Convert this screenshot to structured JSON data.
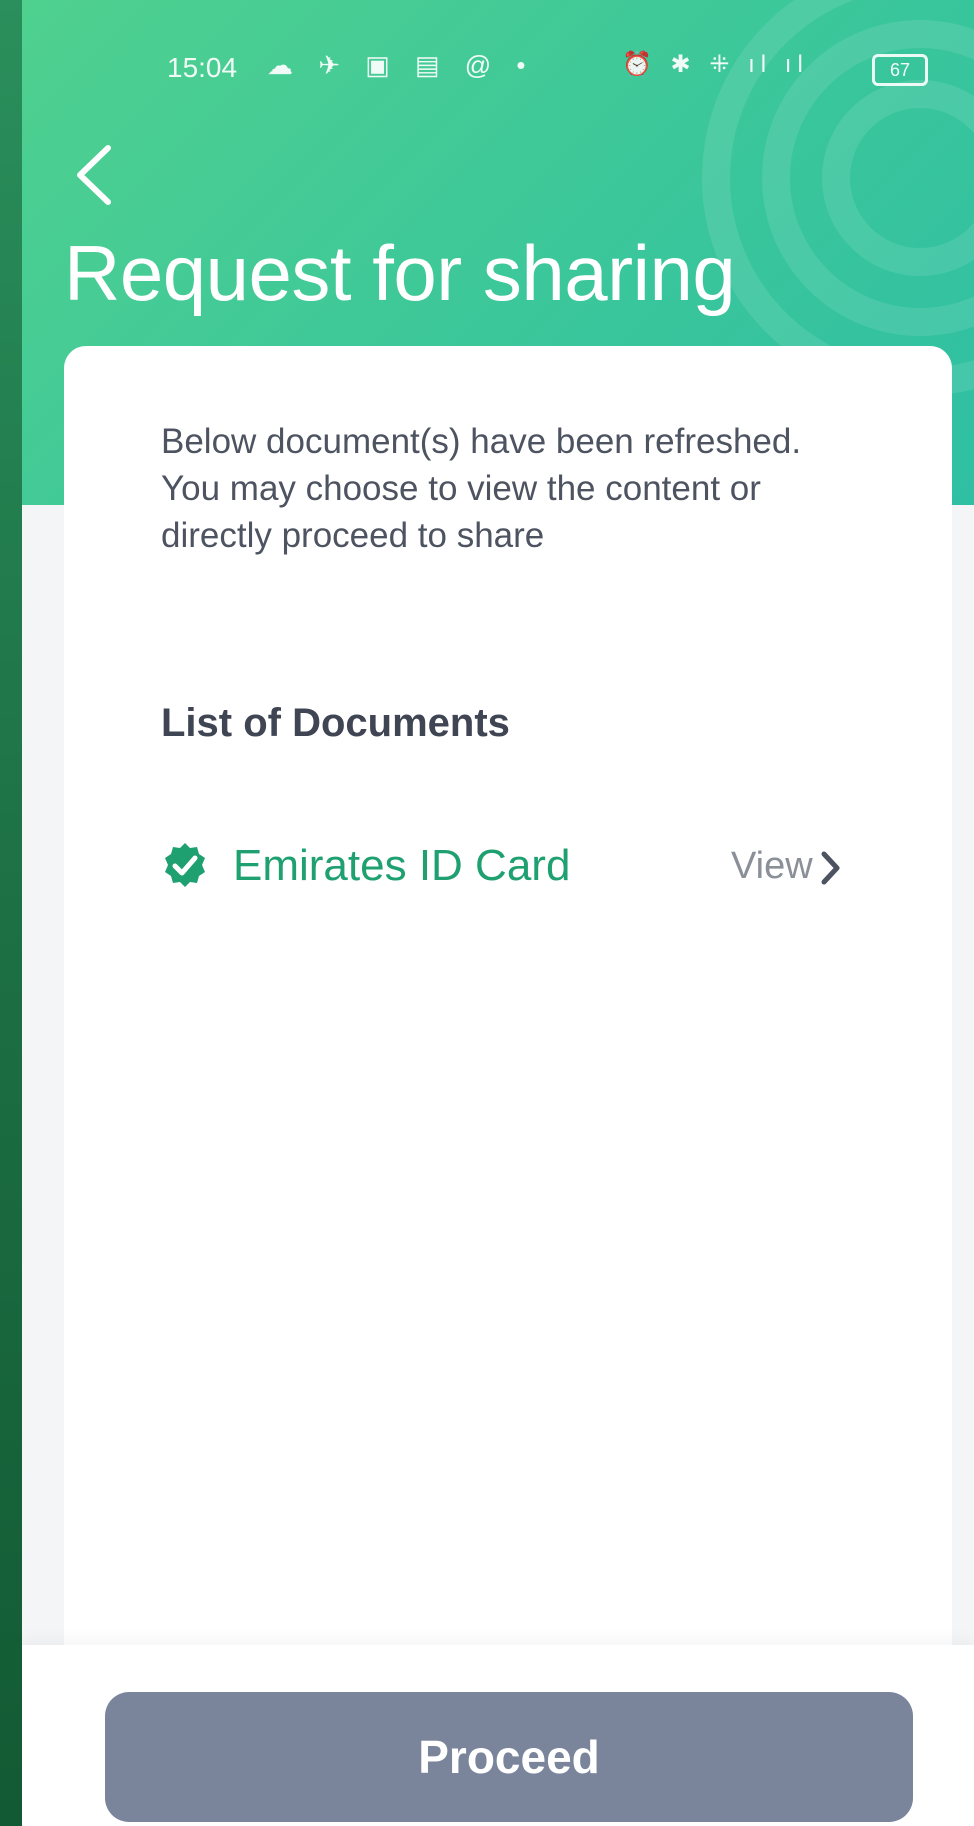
{
  "status_bar": {
    "time": "15:04",
    "left_icons": "☁ ✈ ▣ ▤ @ •",
    "right_icons": "⏰ ✱ ⁜ ıl ıl",
    "battery": "67"
  },
  "header": {
    "title": "Request for sharing",
    "gradient_start": "#4fd08f",
    "gradient_end": "#2fbfa3"
  },
  "card": {
    "description": "Below document(s) have been refreshed. You may choose to view the content or directly proceed to share",
    "section_heading": "List of Documents",
    "documents": [
      {
        "name": "Emirates ID Card",
        "status_icon": "verified-check-icon",
        "action_label": "View"
      }
    ]
  },
  "footer": {
    "proceed_label": "Proceed",
    "button_color": "#7a859c"
  },
  "colors": {
    "accent": "#1fa070",
    "text_primary": "#3f4553",
    "text_secondary": "#8b8f98"
  }
}
